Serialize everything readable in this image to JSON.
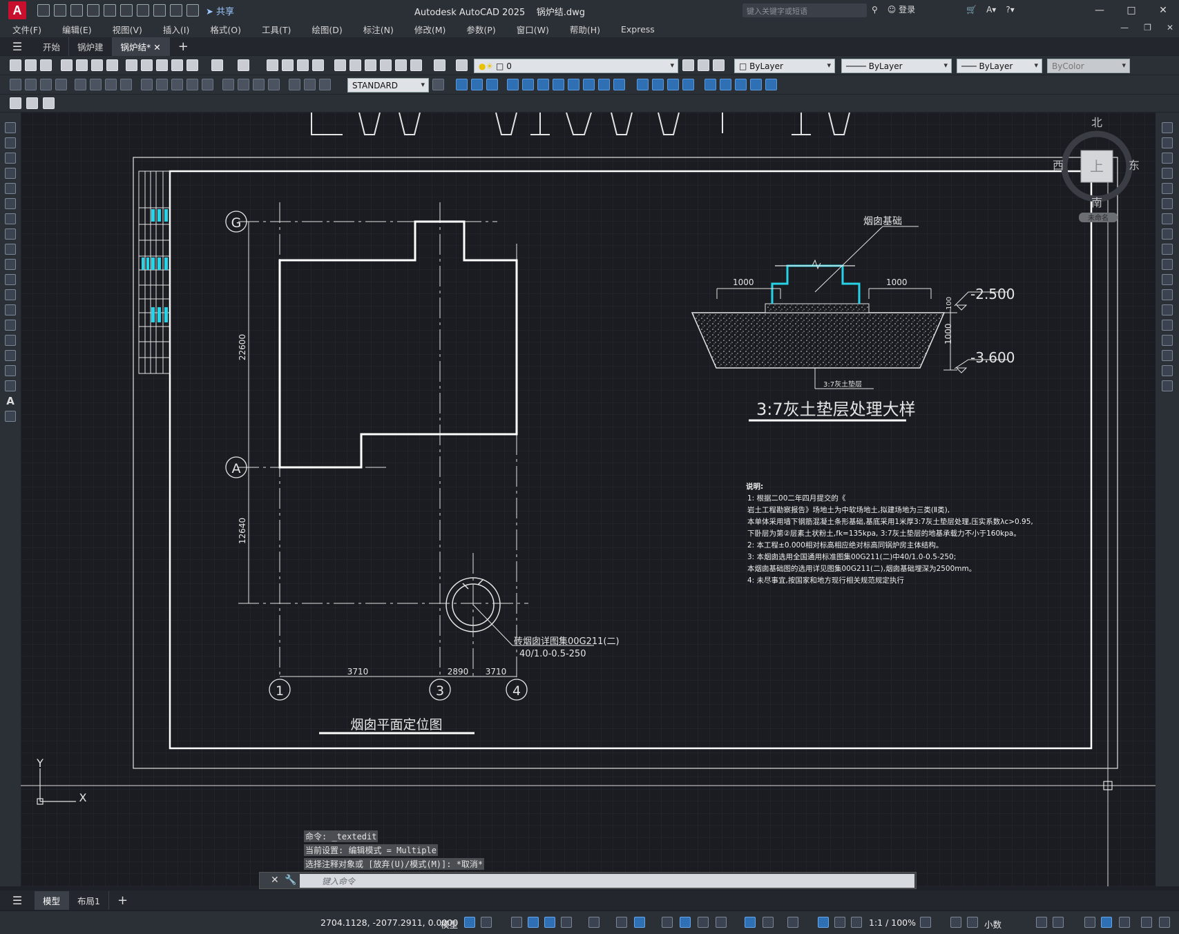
{
  "window": {
    "app_title": "Autodesk AutoCAD 2025",
    "file_title": "锅炉结.dwg",
    "share_label": "共享",
    "search_placeholder": "键入关键字或短语",
    "login_label": "登录"
  },
  "menu": [
    "文件(F)",
    "编辑(E)",
    "视图(V)",
    "插入(I)",
    "格式(O)",
    "工具(T)",
    "绘图(D)",
    "标注(N)",
    "修改(M)",
    "参数(P)",
    "窗口(W)",
    "帮助(H)",
    "Express"
  ],
  "tabs": [
    {
      "label": "开始",
      "active": false
    },
    {
      "label": "锅炉建",
      "active": false
    },
    {
      "label": "锅炉结*",
      "active": true
    }
  ],
  "properties": {
    "layer": "0",
    "color": "ByLayer",
    "linetype": "ByLayer",
    "lineweight": "ByLayer",
    "plotstyle": "ByColor",
    "text_style": "STANDARD"
  },
  "viewcube": {
    "north": "北",
    "south": "南",
    "east": "东",
    "west": "西",
    "face": "上",
    "wcs": "未命名"
  },
  "drawing": {
    "plan_title": "烟囱平面定位图",
    "grid_g": "G",
    "grid_a": "A",
    "grid_1": "1",
    "grid_3": "3",
    "grid_4": "4",
    "dim_22600": "22600",
    "dim_12640": "12640",
    "dim_3710_a": "3710",
    "dim_2890": "2890",
    "dim_3710_b": "3710",
    "chimney_note_1": "砖烟囱详图集00G211(二)",
    "chimney_note_2": "40/1.0-0.5-250",
    "detail_title": "3:7灰土垫层处理大样",
    "detail_label_base": "烟囱基础",
    "detail_dim_left": "1000",
    "detail_dim_right": "1000",
    "detail_dim_100": "100",
    "detail_dim_1000v": "1000",
    "detail_elev_1": "-2.500",
    "detail_elev_2": "-3.600",
    "detail_label_soil": "3:7灰土垫层",
    "notes_title": "说明:",
    "notes": [
      "1: 根据二00二年四月提交的《",
      "   岩土工程勘察报告》场地土为中软场地土,拟建场地为三类(Ⅱ类),",
      "   本单体采用墙下钢筋混凝土条形基础,基底采用1米厚3:7灰土垫层处理,压实系数λc>0.95,",
      "   下卧层为第②层素土状粉土,fk=135kpa, 3:7灰土垫层的地基承载力不小于160kpa。",
      "2: 本工程±0.000相对标高相应绝对标高同锅炉房主体结构。",
      "3: 本烟囱选用全国通用标准图集00G211(二)中40/1.0-0.5-250;",
      "   本烟囱基础图的选用详见图集00G211(二),烟囱基础埋深为2500mm。",
      "4: 未尽事宜,按国家和地方现行相关规范规定执行"
    ]
  },
  "command": {
    "history": [
      "命令: _textedit",
      "当前设置: 编辑模式 = Multiple",
      "选择注释对象或 [放弃(U)/模式(M)]: *取消*"
    ],
    "placeholder": "键入命令"
  },
  "layout_tabs": [
    {
      "label": "模型",
      "active": true
    },
    {
      "label": "布局1",
      "active": false
    }
  ],
  "status": {
    "coords": "2704.1128, -2077.2911, 0.0000",
    "model_label": "模型",
    "scale": "1:1 / 100%",
    "units": "小数"
  },
  "ucs": {
    "y": "Y",
    "x": "X"
  }
}
